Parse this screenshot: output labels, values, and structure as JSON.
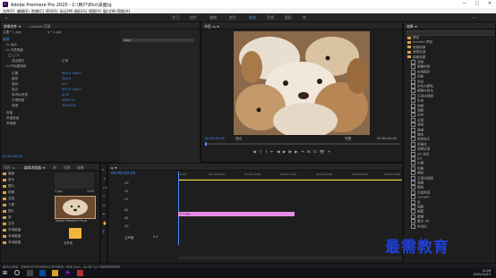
{
  "window": {
    "title": "Adobe Premiere Pro 2020 - C:\\用户\\Ehs\\桌面\\q",
    "logo_text": "Pr",
    "minimize": "—",
    "maximize": "□",
    "close": "✕"
  },
  "menu": [
    "文件(F)",
    "编辑(E)",
    "剪辑(C)",
    "序列(S)",
    "标记(M)",
    "图形(G)",
    "视图(V)",
    "窗口(W)",
    "帮助(H)"
  ],
  "workspaces": [
    "学习",
    "组件",
    "编辑",
    "颜色",
    "效果",
    "音频",
    "图形",
    "库"
  ],
  "workspace_active": "效果",
  "effect_controls": {
    "tabs": [
      "效果控件 ≡",
      "Lumetri 范围"
    ],
    "source": "主要 * 1.jpg",
    "sequence": "q * 1.jpg",
    "clip_label": "1.jpg",
    "timecode": "00:00:00:00",
    "sections": [
      "视频",
      "fx 运动",
      "fx 不透明度",
      "fx 时间重映射"
    ],
    "rows": [
      {
        "name": "混合模式",
        "value": "正常"
      },
      {
        "name": "位置",
        "value": "960.0   540.0"
      },
      {
        "name": "缩放",
        "value": "100.0"
      },
      {
        "name": "旋转",
        "value": "0.0"
      },
      {
        "name": "锚点",
        "value": "960.0   540.0"
      },
      {
        "name": "防闪烁滤镜",
        "value": "0.00"
      },
      {
        "name": "不透明度",
        "value": "100.0 %"
      },
      {
        "name": "速度",
        "value": "100.00%"
      },
      {
        "name": "音量",
        "value": ""
      },
      {
        "name": "声道音量",
        "value": ""
      },
      {
        "name": "声像器",
        "value": ""
      }
    ]
  },
  "program": {
    "title": "节目: q ≡",
    "timecode_left": "00:00:00:00",
    "fit": "适合",
    "quality": "完整",
    "timecode_right": "00:00:05:00",
    "buttons": [
      "◆",
      "{",
      "}",
      "⇤",
      "◀",
      "▶",
      "▶▶",
      "⇥",
      "⊞",
      "⊡",
      "📷",
      "+"
    ]
  },
  "project": {
    "tabs": [
      "项目: q",
      "媒体浏览器 ≡",
      "库",
      "信息",
      "效果"
    ],
    "search_placeholder": "",
    "items": [
      {
        "name": "1.jpg",
        "duration": "5:00"
      },
      {
        "name": "Adobe Premiere Pro.ai"
      },
      {
        "name": "文件夹"
      }
    ],
    "folders": [
      "桌面",
      "音乐",
      "图片",
      "视频",
      "文档",
      "下载",
      "图片",
      "库",
      "文件",
      "本地磁盘",
      "本地磁盘",
      "本地磁盘"
    ]
  },
  "timeline": {
    "title": "q ≡",
    "timecode": "00:00:00:00",
    "ruler": [
      "00:00",
      "00:00:05:00",
      "00:00:10:00",
      "00:00:15:00",
      "00:00:20:00",
      "00:00:25:00",
      "00:00:30:00"
    ],
    "tracks": [
      "V3",
      "V2",
      "V1",
      "A1",
      "A2",
      "A3",
      "主声道"
    ],
    "master_value": "0.0",
    "clip_label": "fx 1.jpg"
  },
  "effects": {
    "title": "效果 ≡",
    "items": [
      "预设",
      "Lumetri 预设",
      "音频效果",
      "音频过渡",
      "视频效果",
      "变换",
      "图像控制",
      "实用程序",
      "扭曲",
      "时间",
      "杂色与颗粒",
      "模糊与锐化",
      "沉浸式视频",
      "生成",
      "视频",
      "调整",
      "过时",
      "过渡",
      "透视",
      "通道",
      "键控",
      "颜色校正",
      "风格化",
      "视频过渡",
      "3D 运动",
      "Iris",
      "内滑",
      "划像",
      "擦除",
      "沉浸式视频",
      "溶解",
      "缩放",
      "页面剥落",
      "Lumetri",
      "库",
      "调整",
      "嵌套",
      "模糊",
      "基本 3D",
      "时间码"
    ]
  },
  "status": {
    "text": "单击以选择，或单击空白处并拖动以进行框选。使用 Shift、Alt 和 Ctrl 可获得其他选项。"
  },
  "taskbar": {
    "time": "11:26",
    "date": "2021/11/15"
  },
  "watermark": "最需教育",
  "colors": {
    "accent": "#4a8cf7",
    "clip": "#e58be6",
    "folder": "#d7a04a",
    "playhead": "#4a8cf7"
  }
}
